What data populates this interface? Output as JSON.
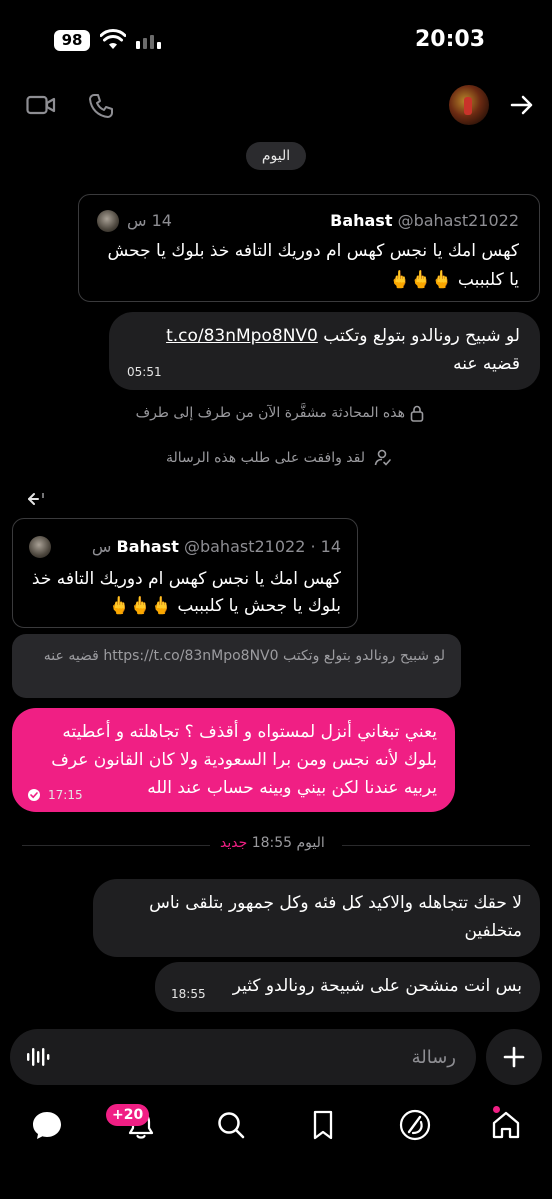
{
  "status_bar": {
    "battery": "98",
    "time": "20:03"
  },
  "header": {
    "video_call_icon": "video-camera-icon",
    "voice_call_icon": "phone-icon",
    "back_icon": "arrow-right-icon"
  },
  "date_chip": "اليوم",
  "quote_card_1": {
    "name": "Bahast",
    "handle": "@bahast21022",
    "time": "14 س",
    "text_line1": "كهس امك يا نجس كهس ام دوريك التافه خذ بلوك يا جحش",
    "text_line2": "يا كلبببب 🖕🖕🖕"
  },
  "message_1": {
    "text_line1_prefix": "لو شبيح رونالدو بتولع وتكتب",
    "link": "t.co/83nMpo8NV0",
    "text_line2": "قضيه عنه",
    "time": "05:51"
  },
  "system": {
    "encrypted": "هذه المحادثة مشفَّرة الآن من طرف إلى طرف",
    "accepted": "لقد وافقت على طلب هذه الرسالة"
  },
  "quote_card_2": {
    "name": "Bahast",
    "handle": "@bahast21022 · 14 س",
    "text_line1": "كهس امك يا نجس كهس ام دوريك التافه خذ",
    "text_line2": "بلوك يا جحش يا كلبببب 🖕🖕🖕"
  },
  "quoted_reply": {
    "text": "لو شبيح رونالدو بتولع وتكتب https://t.co/83nMpo8NV0 قضيه عنه"
  },
  "message_pink": {
    "line1": "يعني تبغاني أنزل لمستواه و أقذف ؟ تجاهلته و أعطيته",
    "line2": "بلوك لأنه نجس ومن برا السعودية ولا كان القانون عرف",
    "line3": "يربيه عندنا لكن بيني وبينه حساب عند الله",
    "time": "17:15"
  },
  "new_divider": {
    "today_time": "اليوم 18:55",
    "new": "جديد"
  },
  "message_2": {
    "line1": "لا حقك تتجاهله والاكيد كل فئه وكل جمهور بتلقى ناس",
    "line2": "متخلفين"
  },
  "message_3": {
    "text": "بس انت منشحن على شبيحة رونالدو كثير",
    "time": "18:55"
  },
  "composer": {
    "placeholder": "رسالة"
  },
  "nav": {
    "badge": "+20"
  }
}
